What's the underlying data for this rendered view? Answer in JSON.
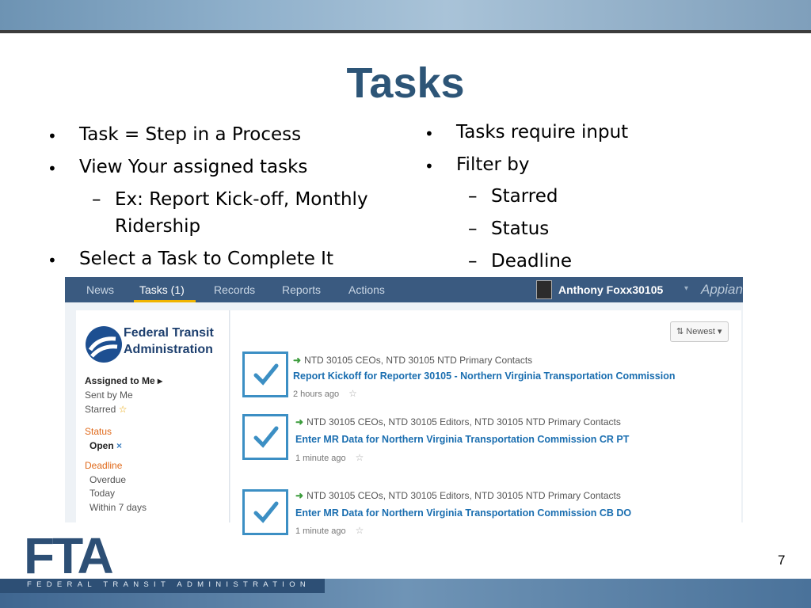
{
  "slide": {
    "title": "Tasks",
    "page_number": "7",
    "left_bullets": [
      "Task = Step in a Process",
      "View Your assigned tasks",
      "Ex:  Report Kick-off, Monthly",
      "Ridership",
      "Select a Task to Complete It"
    ],
    "right_bullets": [
      "Tasks require input",
      "Filter by",
      "Starred",
      "Status",
      "Deadline"
    ],
    "bullet_char": "•",
    "dash_char": "–"
  },
  "app": {
    "nav": {
      "items": [
        "News",
        "Tasks (1)",
        "Records",
        "Reports",
        "Actions"
      ],
      "active": "Tasks (1)",
      "user_name": "Anthony Foxx30105",
      "user_caret": "▾",
      "brand": "Appian"
    },
    "sidebar": {
      "org_line1": "Federal Transit",
      "org_line2": "Administration",
      "assigned": "Assigned to Me ▸",
      "sent": "Sent by Me",
      "starred": "Starred",
      "starred_icon": "☆",
      "status_heading": "Status",
      "status_value": "Open",
      "status_clear": "×",
      "deadline_heading": "Deadline",
      "deadline_options": [
        "Overdue",
        "Today",
        "Within 7 days"
      ]
    },
    "sort": {
      "label": "Newest",
      "icon": "⇅",
      "caret": "▾"
    },
    "tasks": [
      {
        "groups": "NTD 30105 CEOs, NTD 30105 NTD Primary Contacts",
        "title": "Report Kickoff for Reporter 30105 - Northern Virginia Transportation Commission",
        "time": "2 hours ago"
      },
      {
        "groups": "NTD 30105 CEOs, NTD 30105 Editors, NTD 30105 NTD Primary Contacts",
        "title": "Enter MR Data for Northern Virginia Transportation Commission CR PT",
        "time": "1 minute ago"
      },
      {
        "groups": "NTD 30105 CEOs, NTD 30105 Editors, NTD 30105 NTD Primary Contacts",
        "title": "Enter MR Data for Northern Virginia Transportation Commission CB DO",
        "time": "1 minute ago"
      }
    ],
    "star_icon": "☆",
    "arrow_icon": "➜"
  },
  "footer": {
    "logo": "FTA",
    "agency": "FEDERAL TRANSIT ADMINISTRATION"
  },
  "colors": {
    "title": "#2d5577",
    "nav_bar": "#3a5a80",
    "link": "#1a6eb0",
    "accent_orange": "#e06a1b",
    "check_blue": "#3c8fc4"
  }
}
